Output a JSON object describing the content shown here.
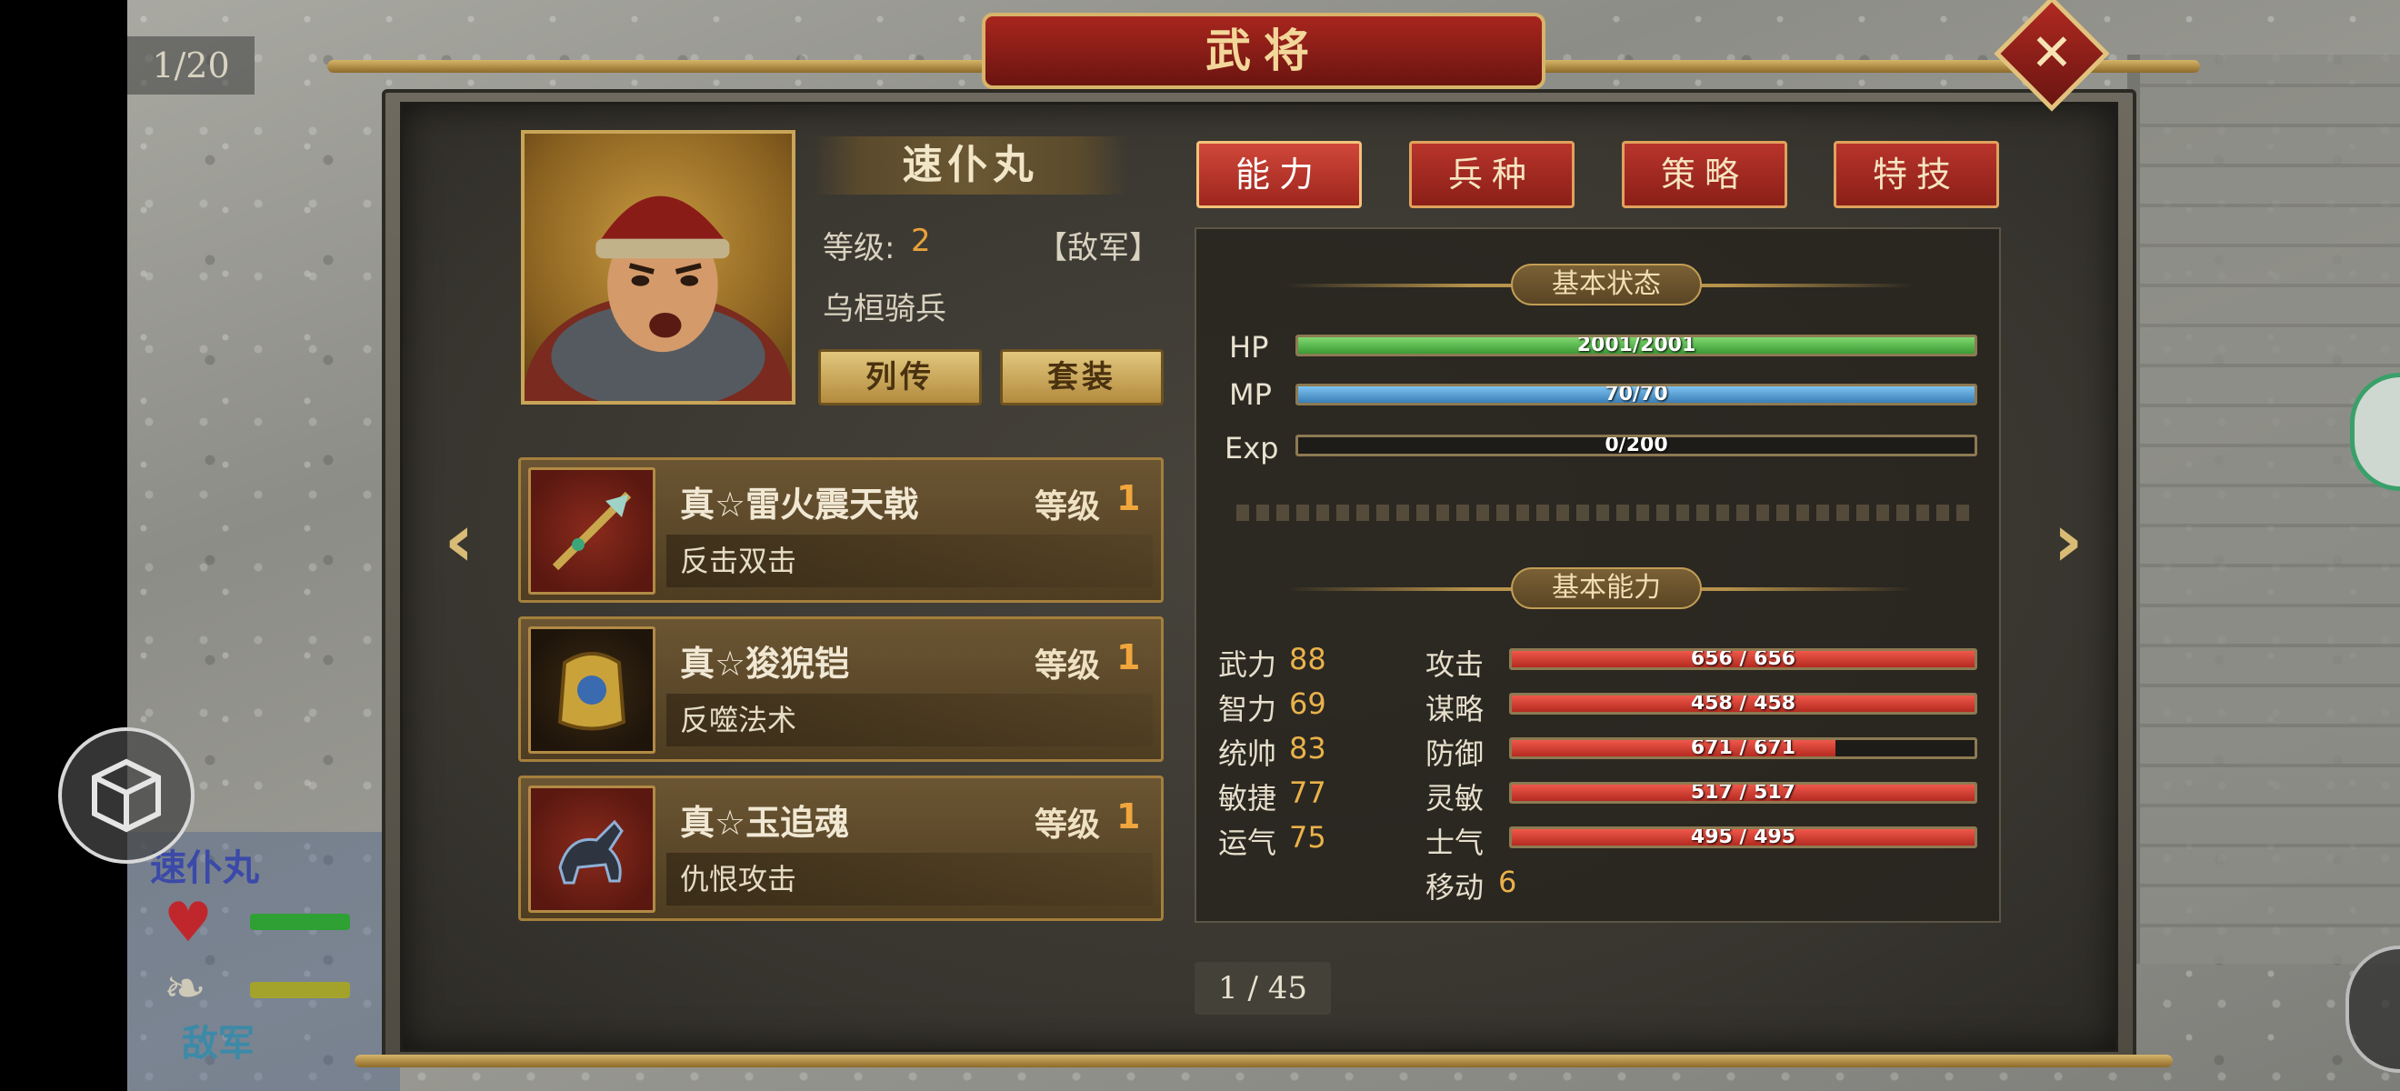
{
  "scene": {
    "turn": "1/20",
    "unit_card": {
      "name": "速仆丸",
      "side": "敌军"
    }
  },
  "panel": {
    "title": "武将",
    "close": "✕"
  },
  "general": {
    "name": "速仆丸",
    "level_label": "等级:",
    "level": "2",
    "faction": "【敌军】",
    "unit_type": "乌桓骑兵",
    "buttons": {
      "biography": "列传",
      "set": "套装"
    }
  },
  "equipment": [
    {
      "name": "真☆雷火震天戟",
      "level_label": "等级",
      "level": "1",
      "skill": "反击双击",
      "icon": "halberd-icon"
    },
    {
      "name": "真☆狻猊铠",
      "level_label": "等级",
      "level": "1",
      "skill": "反噬法术",
      "icon": "armor-icon"
    },
    {
      "name": "真☆玉追魂",
      "level_label": "等级",
      "level": "1",
      "skill": "仇恨攻击",
      "icon": "horse-icon"
    }
  ],
  "tabs": [
    {
      "label": "能力",
      "active": true
    },
    {
      "label": "兵种",
      "active": false
    },
    {
      "label": "策略",
      "active": false
    },
    {
      "label": "特技",
      "active": false
    }
  ],
  "status": {
    "header": "基本状态",
    "hp": {
      "label": "HP",
      "text": "2001/2001",
      "fraction": 1.0
    },
    "mp": {
      "label": "MP",
      "text": "70/70",
      "fraction": 1.0
    },
    "exp": {
      "label": "Exp",
      "text": "0/200",
      "fraction": 0.0
    }
  },
  "ability": {
    "header": "基本能力",
    "attributes": [
      {
        "name": "武力",
        "value": "88"
      },
      {
        "name": "智力",
        "value": "69"
      },
      {
        "name": "统帅",
        "value": "83"
      },
      {
        "name": "敏捷",
        "value": "77"
      },
      {
        "name": "运气",
        "value": "75"
      }
    ],
    "combat": [
      {
        "name": "攻击",
        "text": "656 / 656",
        "fraction": 1.0
      },
      {
        "name": "谋略",
        "text": "458 / 458",
        "fraction": 1.0
      },
      {
        "name": "防御",
        "text": "671 / 671",
        "fraction": 0.7
      },
      {
        "name": "灵敏",
        "text": "517 / 517",
        "fraction": 1.0
      },
      {
        "name": "士气",
        "text": "495 / 495",
        "fraction": 1.0
      }
    ],
    "move_label": "移动",
    "move_value": "6"
  },
  "pagination": {
    "text": "1 / 45"
  },
  "navigation": {
    "prev": "‹",
    "next": "›"
  },
  "colors": {
    "accent_red": "#b8342b",
    "gold": "#d6b56a",
    "value_orange": "#eab24a"
  }
}
